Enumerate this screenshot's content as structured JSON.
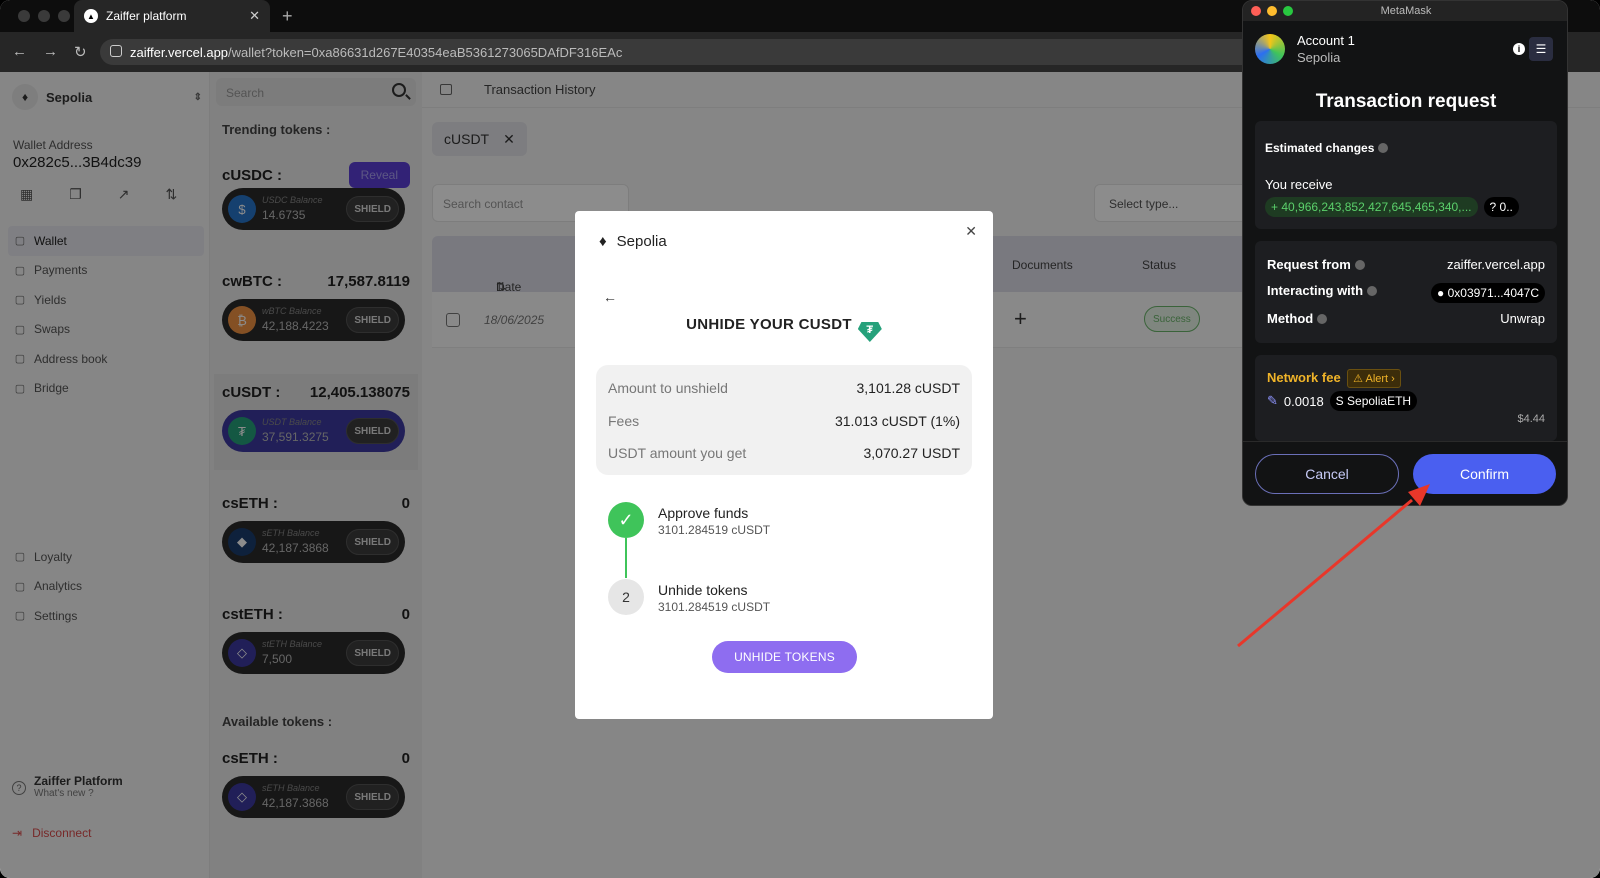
{
  "browser": {
    "tab_title": "Zaiffer platform",
    "url_host": "zaiffer.vercel.app",
    "url_path": "/wallet?token=0xa86631d267E40354eaB5361273065DAfDF316EAc"
  },
  "sidebar": {
    "network": "Sepolia",
    "wallet_label": "Wallet Address",
    "wallet_address": "0x282c5...3B4dc39",
    "items": [
      {
        "label": "Wallet",
        "icon": "wallet-icon"
      },
      {
        "label": "Payments",
        "icon": "payments-icon"
      },
      {
        "label": "Yields",
        "icon": "yields-icon"
      },
      {
        "label": "Swaps",
        "icon": "swaps-icon"
      },
      {
        "label": "Address book",
        "icon": "address-book-icon"
      },
      {
        "label": "Bridge",
        "icon": "bridge-icon"
      }
    ],
    "items2": [
      {
        "label": "Loyalty",
        "icon": "loyalty-icon"
      },
      {
        "label": "Analytics",
        "icon": "analytics-icon"
      },
      {
        "label": "Settings",
        "icon": "gear-icon"
      }
    ],
    "footer_title": "Zaiffer Platform",
    "footer_sub": "What's new ?",
    "disconnect": "Disconnect"
  },
  "tokens": {
    "search_placeholder": "Search",
    "trending_label": "Trending tokens :",
    "available_label": "Available tokens :",
    "reveal_label": "Reveal",
    "shield_label": "SHIELD",
    "list": [
      {
        "name": "cUSDC :",
        "amount": "",
        "balance_label": "USDC Balance",
        "balance": "14.6735",
        "color": "#2775ca",
        "glyph": "$"
      },
      {
        "name": "cwBTC :",
        "amount": "17,587.8119",
        "balance_label": "wBTC Balance",
        "balance": "42,188.4223",
        "color": "#f09242",
        "glyph": "₿"
      },
      {
        "name": "cUSDT :",
        "amount": "12,405.138075",
        "balance_label": "USDT Balance",
        "balance": "37,591.3275",
        "color": "#26a17b",
        "glyph": "₮"
      },
      {
        "name": "csETH :",
        "amount": "0",
        "balance_label": "sETH Balance",
        "balance": "42,187.3868",
        "color": "#1a3c6e",
        "glyph": "◆"
      },
      {
        "name": "cstETH :",
        "amount": "0",
        "balance_label": "stETH Balance",
        "balance": "7,500",
        "color": "#3c3aa0",
        "glyph": "◇"
      },
      {
        "name": "csETH :",
        "amount": "0",
        "balance_label": "sETH Balance",
        "balance": "42,187.3868",
        "color": "#3c3aa0",
        "glyph": "◇"
      }
    ]
  },
  "main": {
    "title": "Transaction History",
    "chip": "cUSDT",
    "search_contact": "Search contact",
    "select_type": "Select type...",
    "columns": {
      "date": "Date",
      "documents": "Documents",
      "status": "Status"
    },
    "row": {
      "date": "18/06/2025",
      "status": "Success"
    }
  },
  "modal": {
    "network": "Sepolia",
    "title": "UNHIDE YOUR CUSDT",
    "rows": [
      {
        "k": "Amount to unshield",
        "v": "3,101.28 cUSDT"
      },
      {
        "k": "Fees",
        "v": "31.013 cUSDT (1%)"
      },
      {
        "k": "USDT amount you get",
        "v": "3,070.27 USDT"
      }
    ],
    "step1_title": "Approve funds",
    "step1_sub": "3101.284519 cUSDT",
    "step2_num": "2",
    "step2_title": "Unhide tokens",
    "step2_sub": "3101.284519 cUSDT",
    "button": "UNHIDE TOKENS"
  },
  "metamask": {
    "window_title": "MetaMask",
    "account": "Account 1",
    "network": "Sepolia",
    "heading": "Transaction request",
    "estimated": "Estimated changes",
    "you_receive": "You receive",
    "receive_amount": "+ 40,966,243,852,427,645,465,340,...",
    "receive_token": "0..",
    "request_from_k": "Request from",
    "request_from_v": "zaiffer.vercel.app",
    "interacting_k": "Interacting with",
    "interacting_v": "0x03971...4047C",
    "method_k": "Method",
    "method_v": "Unwrap",
    "network_fee": "Network fee",
    "alert": "Alert",
    "fee_amount": "0.0018",
    "fee_token": "SepoliaETH",
    "fee_usd": "$4.44",
    "cancel": "Cancel",
    "confirm": "Confirm"
  },
  "colors": {
    "accent": "#8e6df0",
    "confirm": "#4a5ff0",
    "arrow": "#e8372a",
    "success": "#3fc45a"
  }
}
